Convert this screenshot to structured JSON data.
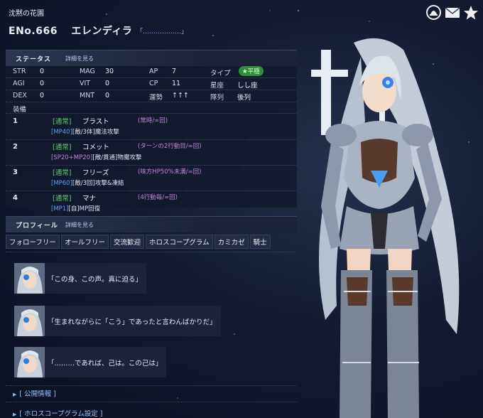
{
  "header": {
    "garden": "沈黙の花園",
    "eno": "ENo.666",
    "name": "エレンディラ",
    "title_tag": "「………………」"
  },
  "header_icons": [
    "bell-icon",
    "mail-icon",
    "star-icon"
  ],
  "status": {
    "title": "ステータス",
    "more": "詳細を見る",
    "rows": [
      {
        "a": "STR",
        "av": "0",
        "b": "MAG",
        "bv": "30",
        "c": "AP",
        "cv": "7",
        "d": "タイプ",
        "dv": "★平穏"
      },
      {
        "a": "AGI",
        "av": "0",
        "b": "VIT",
        "bv": "0",
        "c": "CP",
        "cv": "11",
        "d": "星座",
        "dv": "しし座"
      },
      {
        "a": "DEX",
        "av": "0",
        "b": "MNT",
        "bv": "0",
        "c": "運勢",
        "cv": "↑↑↑",
        "d": "隊列",
        "dv": "後列"
      }
    ],
    "equip_label": "装備"
  },
  "equipment": [
    {
      "num": "1",
      "kind": "[通常]",
      "name": "ブラスト",
      "timing": "(常時/∞回)",
      "cost": "[MP40]",
      "effect": "[敵/3体]魔法攻撃"
    },
    {
      "num": "2",
      "kind": "[通常]",
      "name": "コメット",
      "timing": "(ターンの2行動目/∞回)",
      "cost": "[SP20+MP20]",
      "effect": "[敵/貫通]物魔攻撃"
    },
    {
      "num": "3",
      "kind": "[通常]",
      "name": "フリーズ",
      "timing": "(味方HP50%未満/∞回)",
      "cost": "[MP60]",
      "effect": "[敵/3回]攻撃&凍結"
    },
    {
      "num": "4",
      "kind": "[通常]",
      "name": "マナ",
      "timing": "(4行動毎/∞回)",
      "cost": "[MP1]",
      "effect": "[自]MP回復"
    }
  ],
  "profile": {
    "title": "プロフィール",
    "more": "詳細を見る",
    "tags": [
      "フォローフリー",
      "オールフリー",
      "交流歓迎",
      "ホロスコープグラム",
      "カミカゼ",
      "騎士"
    ]
  },
  "messages": [
    "「この身、この声。真に迫る」",
    "「生まれながらに「こう」であったと言わんばかりだ」",
    "「………であれば、己は。この己は」"
  ],
  "links": [
    "[ 公開情報 ]",
    "[ ホロスコープグラム設定 ]"
  ],
  "colors": {
    "accent_green": "#2e8f3a",
    "link_blue": "#9cc0ff",
    "timing_purple": "#c080e0",
    "cost_blue": "#5aa0ff"
  }
}
